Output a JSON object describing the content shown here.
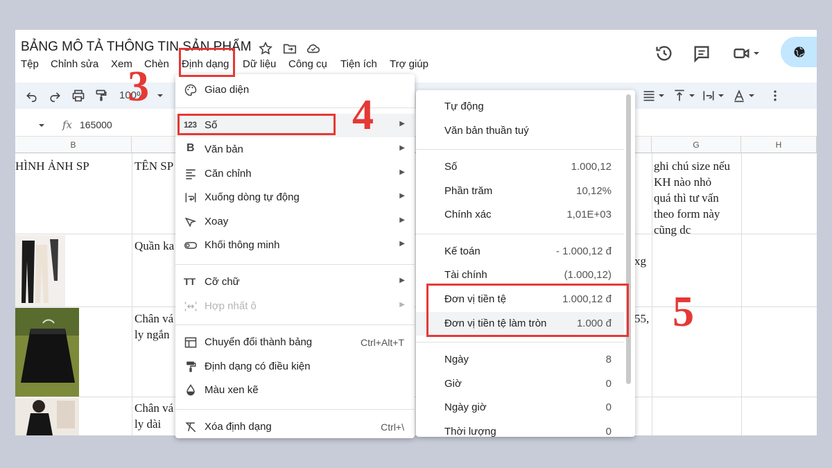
{
  "doc": {
    "title": "BẢNG MÔ TẢ THÔNG TIN SẢN PHẨM"
  },
  "menubar": {
    "items": [
      "Tệp",
      "Chỉnh sửa",
      "Xem",
      "Chèn",
      "Định dạng",
      "Dữ liệu",
      "Công cụ",
      "Tiện ích",
      "Trợ giúp"
    ]
  },
  "toolbar": {
    "zoom": "100%"
  },
  "formula_bar": {
    "fx": "fx",
    "value": "165000"
  },
  "grid": {
    "columns": [
      "B",
      "G",
      "H"
    ],
    "cells": {
      "b_header": "HÌNH ẢNH SP",
      "c_header": "TÊN SP",
      "g_note": [
        "ghi chú size nếu",
        "KH nào nhỏ",
        "quá thì tư vấn",
        "theo form này",
        "cũng dc"
      ],
      "c_row1": "Quần ka",
      "c_row2": [
        "Chân vá",
        "ly ngắn"
      ],
      "c_row3": [
        "Chân vá",
        "ly dài"
      ],
      "f_row1": "xg",
      "f_row2": "55,"
    }
  },
  "format_menu": {
    "items": [
      {
        "label": "Giao diện",
        "icon": "palette-icon"
      },
      {
        "label": "Số",
        "icon": "number-format-icon",
        "icon_text": "123"
      },
      {
        "label": "Văn bản",
        "icon": "bold-icon",
        "icon_text": "B"
      },
      {
        "label": "Căn chỉnh",
        "icon": "align-left-icon"
      },
      {
        "label": "Xuống dòng tự động",
        "icon": "text-wrap-icon"
      },
      {
        "label": "Xoay",
        "icon": "text-rotation-icon"
      },
      {
        "label": "Khối thông minh",
        "icon": "smart-chip-icon"
      },
      {
        "label": "Cỡ chữ",
        "icon": "font-size-icon",
        "icon_text": "TT"
      },
      {
        "label": "Hợp nhất ô",
        "icon": "merge-cells-icon"
      },
      {
        "label": "Chuyển đổi thành bảng",
        "icon": "table-icon",
        "shortcut": "Ctrl+Alt+T"
      },
      {
        "label": "Định dạng có điều kiện",
        "icon": "paint-roller-icon"
      },
      {
        "label": "Màu xen kẽ",
        "icon": "fill-drop-icon"
      },
      {
        "label": "Xóa định dạng",
        "icon": "clear-format-icon",
        "shortcut": "Ctrl+\\"
      }
    ]
  },
  "number_menu": {
    "items": [
      {
        "label": "Tự động",
        "value": ""
      },
      {
        "label": "Văn bản thuần tuý",
        "value": ""
      },
      {
        "label": "Số",
        "value": "1.000,12"
      },
      {
        "label": "Phần trăm",
        "value": "10,12%"
      },
      {
        "label": "Chính xác",
        "value": "1,01E+03"
      },
      {
        "label": "Kế toán",
        "value": "- 1.000,12 đ"
      },
      {
        "label": "Tài chính",
        "value": "(1.000,12)"
      },
      {
        "label": "Đơn vị tiền tệ",
        "value": "1.000,12 đ"
      },
      {
        "label": "Đơn vị tiền tệ làm tròn",
        "value": "1.000 đ"
      },
      {
        "label": "Ngày",
        "value": "8"
      },
      {
        "label": "Giờ",
        "value": "0"
      },
      {
        "label": "Ngày giờ",
        "value": "0"
      },
      {
        "label": "Thời lượng",
        "value": "0"
      }
    ]
  },
  "annotations": {
    "step3": "3",
    "step4": "4",
    "step5": "5"
  },
  "colors": {
    "accent_red": "#e53935",
    "share_pill": "#c2e7ff",
    "toolbar_bg": "#eef2f9"
  }
}
